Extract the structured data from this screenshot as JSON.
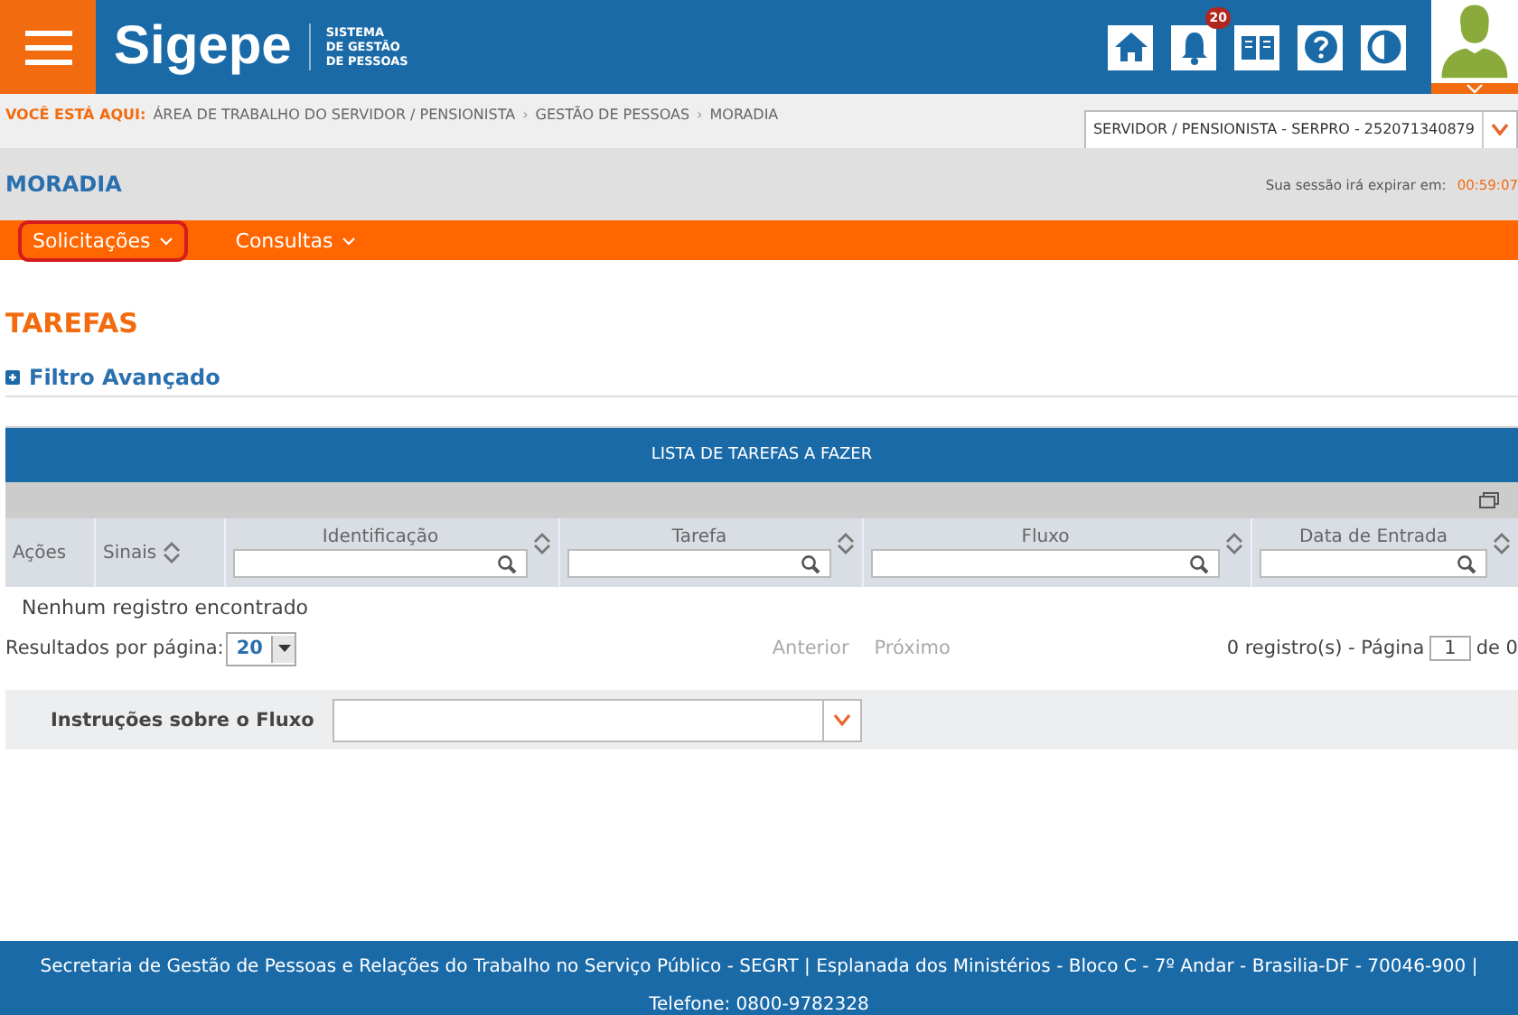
{
  "header": {
    "logo": "Sigepe",
    "subtitle": [
      "SISTEMA",
      "DE GESTÃO",
      "DE PESSOAS"
    ],
    "notification_count": "20"
  },
  "breadcrumb": {
    "label": "VOCÊ ESTÁ AQUI:",
    "items": [
      "ÁREA DE TRABALHO DO SERVIDOR / PENSIONISTA",
      "GESTÃO DE PESSOAS",
      "MORADIA"
    ],
    "separator": "›"
  },
  "profile_select": {
    "value": "SERVIDOR / PENSIONISTA - SERPRO - 252071340879"
  },
  "page_title": "MORADIA",
  "session": {
    "label": "Sua sessão irá expirar em:",
    "time": "00:59:07"
  },
  "menu": [
    {
      "label": "Solicitações",
      "highlighted": true
    },
    {
      "label": "Consultas",
      "highlighted": false
    }
  ],
  "section_title": "TAREFAS",
  "filter_toggle": {
    "label": "Filtro Avançado",
    "expanded": false
  },
  "table": {
    "title": "LISTA DE TAREFAS A FAZER",
    "columns": [
      {
        "label": "Ações",
        "sortable": false,
        "filterable": false
      },
      {
        "label": "Sinais",
        "sortable": true,
        "filterable": false
      },
      {
        "label": "Identificação",
        "sortable": true,
        "filterable": true
      },
      {
        "label": "Tarefa",
        "sortable": true,
        "filterable": true
      },
      {
        "label": "Fluxo",
        "sortable": true,
        "filterable": true
      },
      {
        "label": "Data de Entrada",
        "sortable": true,
        "filterable": true
      }
    ],
    "empty_message": "Nenhum registro encontrado"
  },
  "pagination": {
    "per_page_label": "Resultados por página:",
    "per_page": "20",
    "previous": "Anterior",
    "next": "Próximo",
    "count": "0 registro(s) - Página",
    "page": "1",
    "of": "de 0"
  },
  "instructions": {
    "label": "Instruções sobre o Fluxo"
  },
  "footer": "Secretaria de Gestão de Pessoas e Relações do Trabalho no Serviço Público - SEGRT | Esplanada dos Ministérios - Bloco C - 7º Andar - Brasilia-DF - 70046-900 | Telefone: 0800-9782328"
}
